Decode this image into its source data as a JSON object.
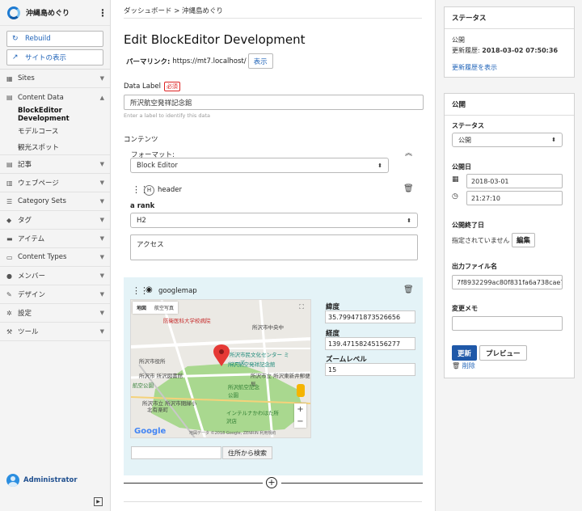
{
  "sidebar": {
    "site_name": "沖縄島めぐり",
    "rebuild_label": "Rebuild",
    "view_site_label": "サイトの表示",
    "nav": [
      {
        "label": "Sites",
        "icon": "sites-icon"
      },
      {
        "label": "Content Data",
        "icon": "content-data-icon"
      }
    ],
    "content_data_items": [
      "BlockEditor Development",
      "モデルコース",
      "観光スポット"
    ],
    "nav2": [
      {
        "label": "記事",
        "icon": "entry-icon"
      },
      {
        "label": "ウェブページ",
        "icon": "webpage-icon"
      },
      {
        "label": "Category Sets",
        "icon": "category-icon"
      },
      {
        "label": "タグ",
        "icon": "tag-icon"
      },
      {
        "label": "アイテム",
        "icon": "asset-icon"
      },
      {
        "label": "Content Types",
        "icon": "content-type-icon"
      },
      {
        "label": "メンバー",
        "icon": "member-icon"
      },
      {
        "label": "デザイン",
        "icon": "design-icon"
      },
      {
        "label": "設定",
        "icon": "gear-icon"
      },
      {
        "label": "ツール",
        "icon": "wrench-icon"
      }
    ],
    "user": "Administrator"
  },
  "main": {
    "breadcrumb": "ダッシュボード  >  沖縄島めぐり",
    "title": "Edit BlockEditor Development",
    "permalink_label": "パーマリンク:",
    "permalink_url": "https://mt7.localhost/",
    "view_button": "表示",
    "data_label": "Data Label",
    "required": "必須",
    "data_label_value": "所沢航空発祥記念館",
    "data_label_hint": "Enter a label to identify this data",
    "contents_label": "コンテンツ",
    "format_label": "フォーマット:",
    "format_value": "Block Editor",
    "header_block": {
      "name": "header",
      "rank_label": "a rank",
      "rank_value": "H2",
      "text": "アクセス"
    },
    "map_block": {
      "name": "googlemap",
      "tab_map": "地図",
      "tab_satellite": "航空写真",
      "lat_label": "緯度",
      "lat_value": "35.799471873526656",
      "lng_label": "経度",
      "lng_value": "139.47158245156277",
      "zoom_label": "ズームレベル",
      "zoom_value": "15",
      "geocode_button": "住所から検索",
      "attribution": "地図データ ©2018 Google, ZENRIN  利用規約",
      "labels": [
        "防衛医科大学校病院",
        "所沢市役所",
        "所沢市民文化センター ミューズ",
        "所沢航空発祥記念館",
        "所沢市 所沢図書館",
        "航空公園",
        "所沢市立 所沢東新井郵便局",
        "所沢航空記念公園",
        "北有楽町",
        "インテルナかわはた所沢店",
        "所沢市中央中",
        "所沢市立 所沢市閉緑小",
        "所沢市"
      ]
    }
  },
  "status": {
    "title": "ステータス",
    "state": "公開",
    "modified_label": "更新履歴:",
    "modified": "2018-03-02 07:50:36",
    "history_link": "更新履歴を表示"
  },
  "publish": {
    "title": "公開",
    "status_label": "ステータス",
    "status_value": "公開",
    "date_label": "公開日",
    "date_value": "2018-03-01",
    "time_value": "21:27:10",
    "end_label": "公開終了日",
    "end_value": "指定されていません",
    "edit_button": "編集",
    "file_label": "出力ファイル名",
    "file_value": "7f8932299ac80f831fa6a738cae7be",
    "memo_label": "変更メモ",
    "update_button": "更新",
    "preview_button": "プレビュー",
    "delete_link": "削除"
  }
}
